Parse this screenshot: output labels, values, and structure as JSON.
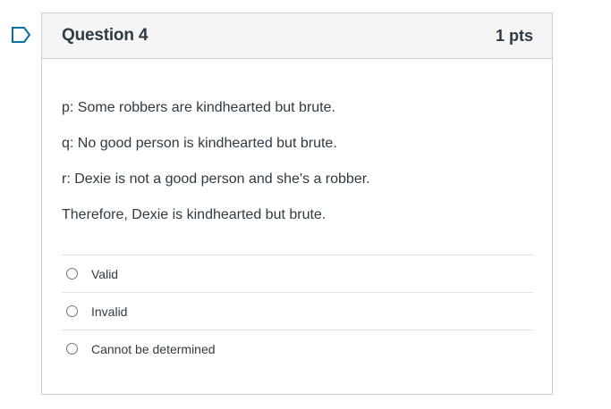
{
  "question": {
    "title": "Question 4",
    "points": "1 pts",
    "flag_icon": "bookmark-flag-icon",
    "flag_color": "#0770a3"
  },
  "statements": [
    "p: Some robbers are kindhearted but brute.",
    "q: No good person is kindhearted but brute.",
    "r: Dexie is not a good person and she's a robber.",
    "Therefore, Dexie is kindhearted but brute."
  ],
  "answers": [
    {
      "label": "Valid",
      "selected": false
    },
    {
      "label": "Invalid",
      "selected": false
    },
    {
      "label": "Cannot be determined",
      "selected": false
    }
  ]
}
